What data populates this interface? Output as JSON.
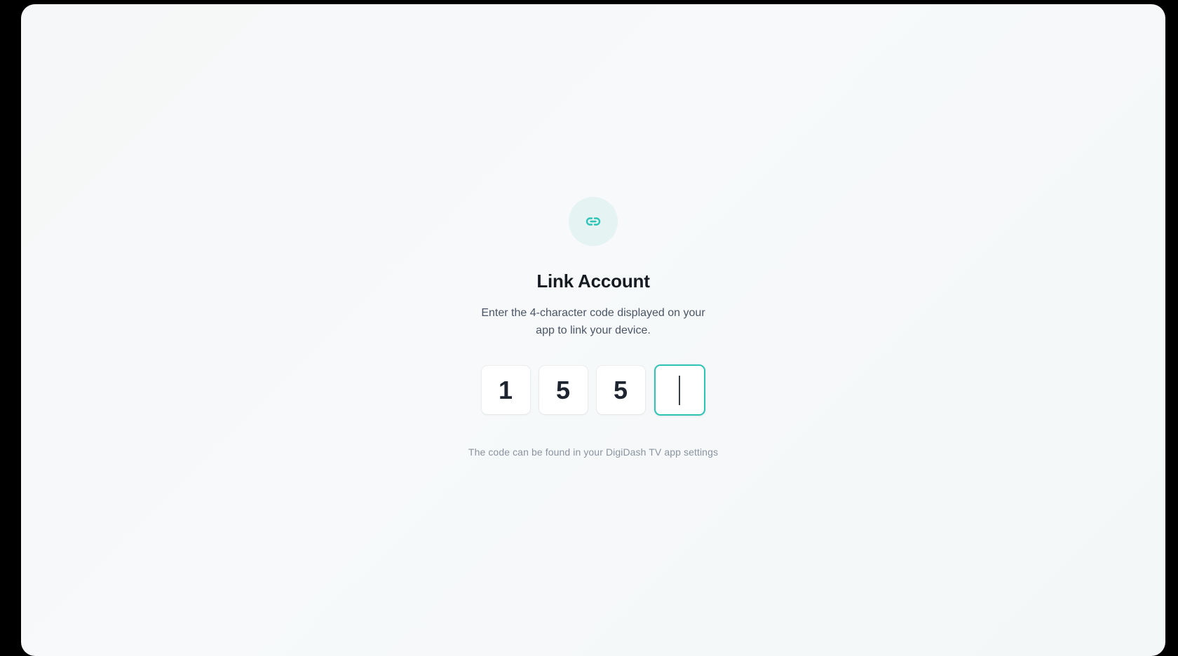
{
  "link_icon": "link-icon",
  "accent_color": "#2ec4b6",
  "title": "Link Account",
  "subtitle": "Enter the 4-character code displayed on your app to link your device.",
  "code": {
    "digits": [
      "1",
      "5",
      "5",
      ""
    ],
    "active_index": 3
  },
  "hint": "The code can be found in your DigiDash TV app settings"
}
